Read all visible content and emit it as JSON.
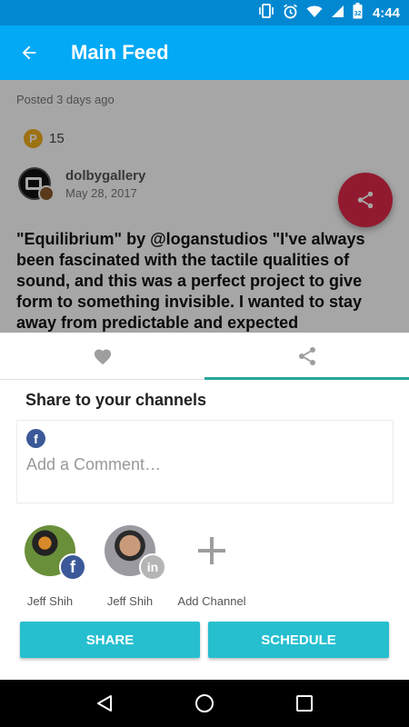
{
  "status_bar": {
    "time": "4:44",
    "icons": [
      "vibrate-icon",
      "alarm-icon",
      "wifi-icon",
      "signal-icon",
      "battery-icon"
    ]
  },
  "app_bar": {
    "title": "Main Feed",
    "back_icon": "arrow-left-icon"
  },
  "post": {
    "posted_ago": "Posted 3 days ago",
    "points_badge": "P",
    "points": "15",
    "author_name": "dolbygallery",
    "author_date": "May 28, 2017",
    "text": "\"Equilibrium\" by @loganstudios      \"I've always been fascinated with the tactile qualities of sound, and this was a perfect project to give form to something invisible. I wanted to stay away from predictable and expected"
  },
  "fab": {
    "icon": "share-icon",
    "color": "#e0284a"
  },
  "share_sheet": {
    "tabs": [
      {
        "icon": "heart-icon",
        "active": false
      },
      {
        "icon": "share-icon",
        "active": true
      }
    ],
    "title": "Share to your channels",
    "comment": {
      "network_icon": "facebook-icon",
      "fb_letter": "f",
      "placeholder": "Add a Comment…",
      "value": ""
    },
    "channels": [
      {
        "name": "Jeff Shih",
        "network": "facebook",
        "badge_letter": "f",
        "badge_color": "#3b5998"
      },
      {
        "name": "Jeff Shih",
        "network": "linkedin",
        "badge_letter": "in",
        "badge_color": "#b5b5b5"
      }
    ],
    "add_channel_label": "Add Channel",
    "share_button": "SHARE",
    "schedule_button": "SCHEDULE",
    "accent_color": "#26bfd0",
    "tab_indicator_color": "#26a69a"
  },
  "nav_bar": {
    "icons": [
      "back-triangle-icon",
      "home-circle-icon",
      "recents-square-icon"
    ]
  }
}
